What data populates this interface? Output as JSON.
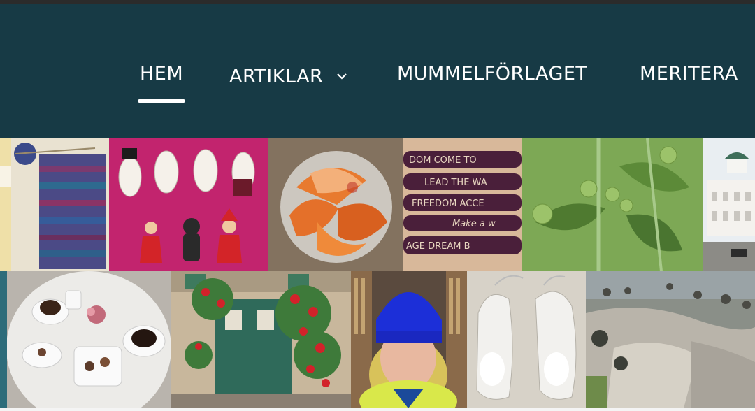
{
  "nav": {
    "home": "HEM",
    "articles": "ARTIKLAR",
    "publisher": "MUMMELFÖRLAGET",
    "merits": "MERITERA"
  },
  "photo_grid": {
    "rows": [
      [
        "knitted-scarf",
        "moomin-figures",
        "blood-oranges",
        "wristbands",
        "tomato-plant",
        "helsinki-cathedral"
      ],
      [
        "cafe-table",
        "rose-doorway",
        "woman-blue-hat",
        "white-shoes",
        "rocky-shore"
      ]
    ]
  },
  "wristbands": {
    "line1": "DOM   COME TO",
    "line2": "LEAD THE WA",
    "line3": "FREEDOM  ACCE",
    "line4": "Make a w",
    "line5": "AGE   DREAM   B"
  },
  "colors": {
    "header_bg": "#173a45",
    "nav_text": "#ffffff"
  }
}
